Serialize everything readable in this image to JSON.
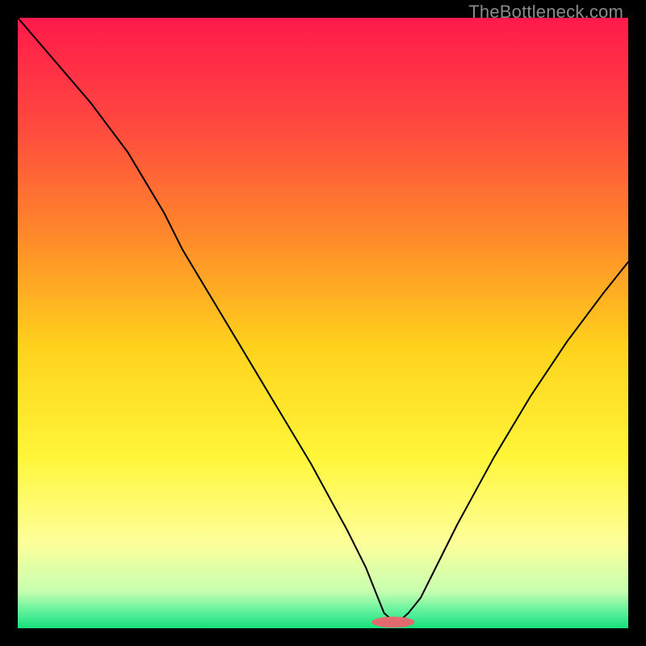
{
  "watermark": "TheBottleneck.com",
  "chart_data": {
    "type": "line",
    "title": "",
    "xlabel": "",
    "ylabel": "",
    "xlim": [
      0,
      100
    ],
    "ylim": [
      0,
      100
    ],
    "grid": false,
    "legend": false,
    "background": {
      "type": "vertical-gradient",
      "stops": [
        {
          "pos": 0.0,
          "color": "#ff1a4b"
        },
        {
          "pos": 0.18,
          "color": "#ff4a3f"
        },
        {
          "pos": 0.36,
          "color": "#ff8a2a"
        },
        {
          "pos": 0.54,
          "color": "#ffd21c"
        },
        {
          "pos": 0.72,
          "color": "#fff63a"
        },
        {
          "pos": 0.86,
          "color": "#fdff9a"
        },
        {
          "pos": 0.94,
          "color": "#c6ffb0"
        },
        {
          "pos": 0.975,
          "color": "#57f09a"
        },
        {
          "pos": 1.0,
          "color": "#18e07a"
        }
      ]
    },
    "series": [
      {
        "name": "bottleneck-curve",
        "color": "#000000",
        "stroke_width": 2,
        "x": [
          0,
          6,
          12,
          18,
          24,
          27,
          30,
          36,
          42,
          48,
          54,
          57,
          59,
          60,
          61,
          62,
          63,
          64,
          66,
          68,
          72,
          78,
          84,
          90,
          96,
          100
        ],
        "y": [
          100,
          93,
          86,
          78,
          68,
          62,
          57,
          47,
          37,
          27,
          16,
          10,
          5,
          2.5,
          1.6,
          1.3,
          1.6,
          2.5,
          5,
          9,
          17,
          28,
          38,
          47,
          55,
          60
        ]
      }
    ],
    "marker": {
      "name": "min-region-pill",
      "color": "#e26a6f",
      "cx": 61.5,
      "cy": 1.0,
      "rx": 3.5,
      "ry": 0.9
    }
  }
}
